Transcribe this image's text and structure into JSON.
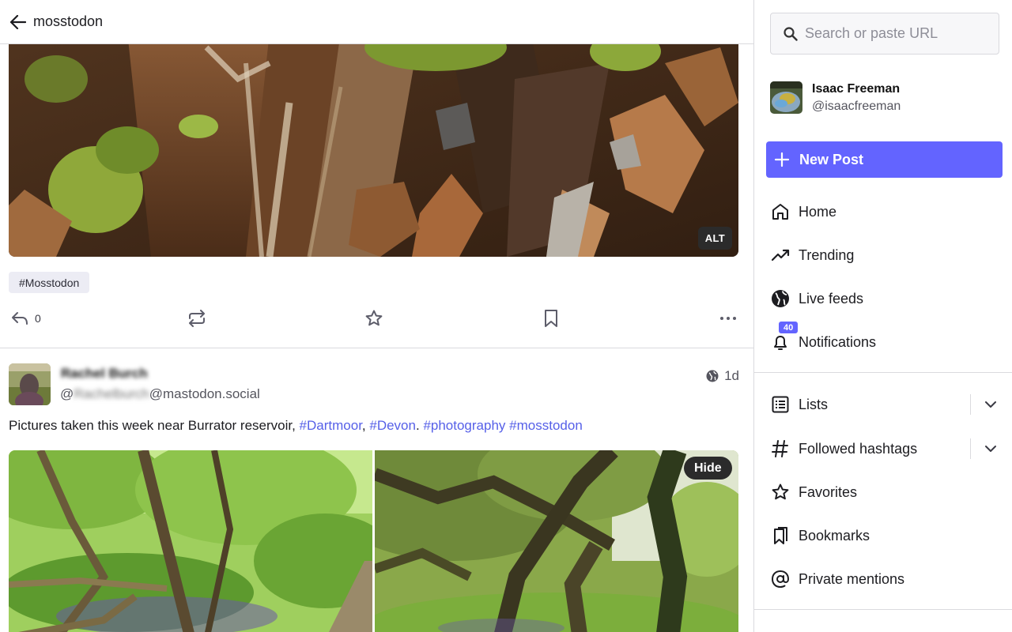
{
  "header": {
    "title": "mosstodon"
  },
  "post1": {
    "alt_label": "ALT",
    "hashtag": "#Mosstodon",
    "reply_count": "0"
  },
  "post2": {
    "display_name": "Rachel Burch",
    "handle_prefix": "@",
    "handle_user": "Rachelburch",
    "handle_domain": "@mastodon.social",
    "time": "1d",
    "text_plain": "Pictures taken this week near Burrator reservoir, ",
    "tag1": "#Dartmoor",
    "sep1": ", ",
    "tag2": "#Devon",
    "sep2": ". ",
    "tag3": "#photography",
    "sep3": " ",
    "tag4": "#mosstodon",
    "hide_label": "Hide"
  },
  "sidebar": {
    "search_placeholder": "Search or paste URL",
    "account_name": "Isaac Freeman",
    "account_handle": "@isaacfreeman",
    "new_post_label": "New Post",
    "nav": {
      "home": "Home",
      "trending": "Trending",
      "live": "Live feeds",
      "notifications": "Notifications",
      "notifications_count": "40",
      "lists": "Lists",
      "hashtags": "Followed hashtags",
      "favorites": "Favorites",
      "bookmarks": "Bookmarks",
      "mentions": "Private mentions"
    }
  },
  "colors": {
    "accent": "#6364ff",
    "link": "#5660e8"
  }
}
